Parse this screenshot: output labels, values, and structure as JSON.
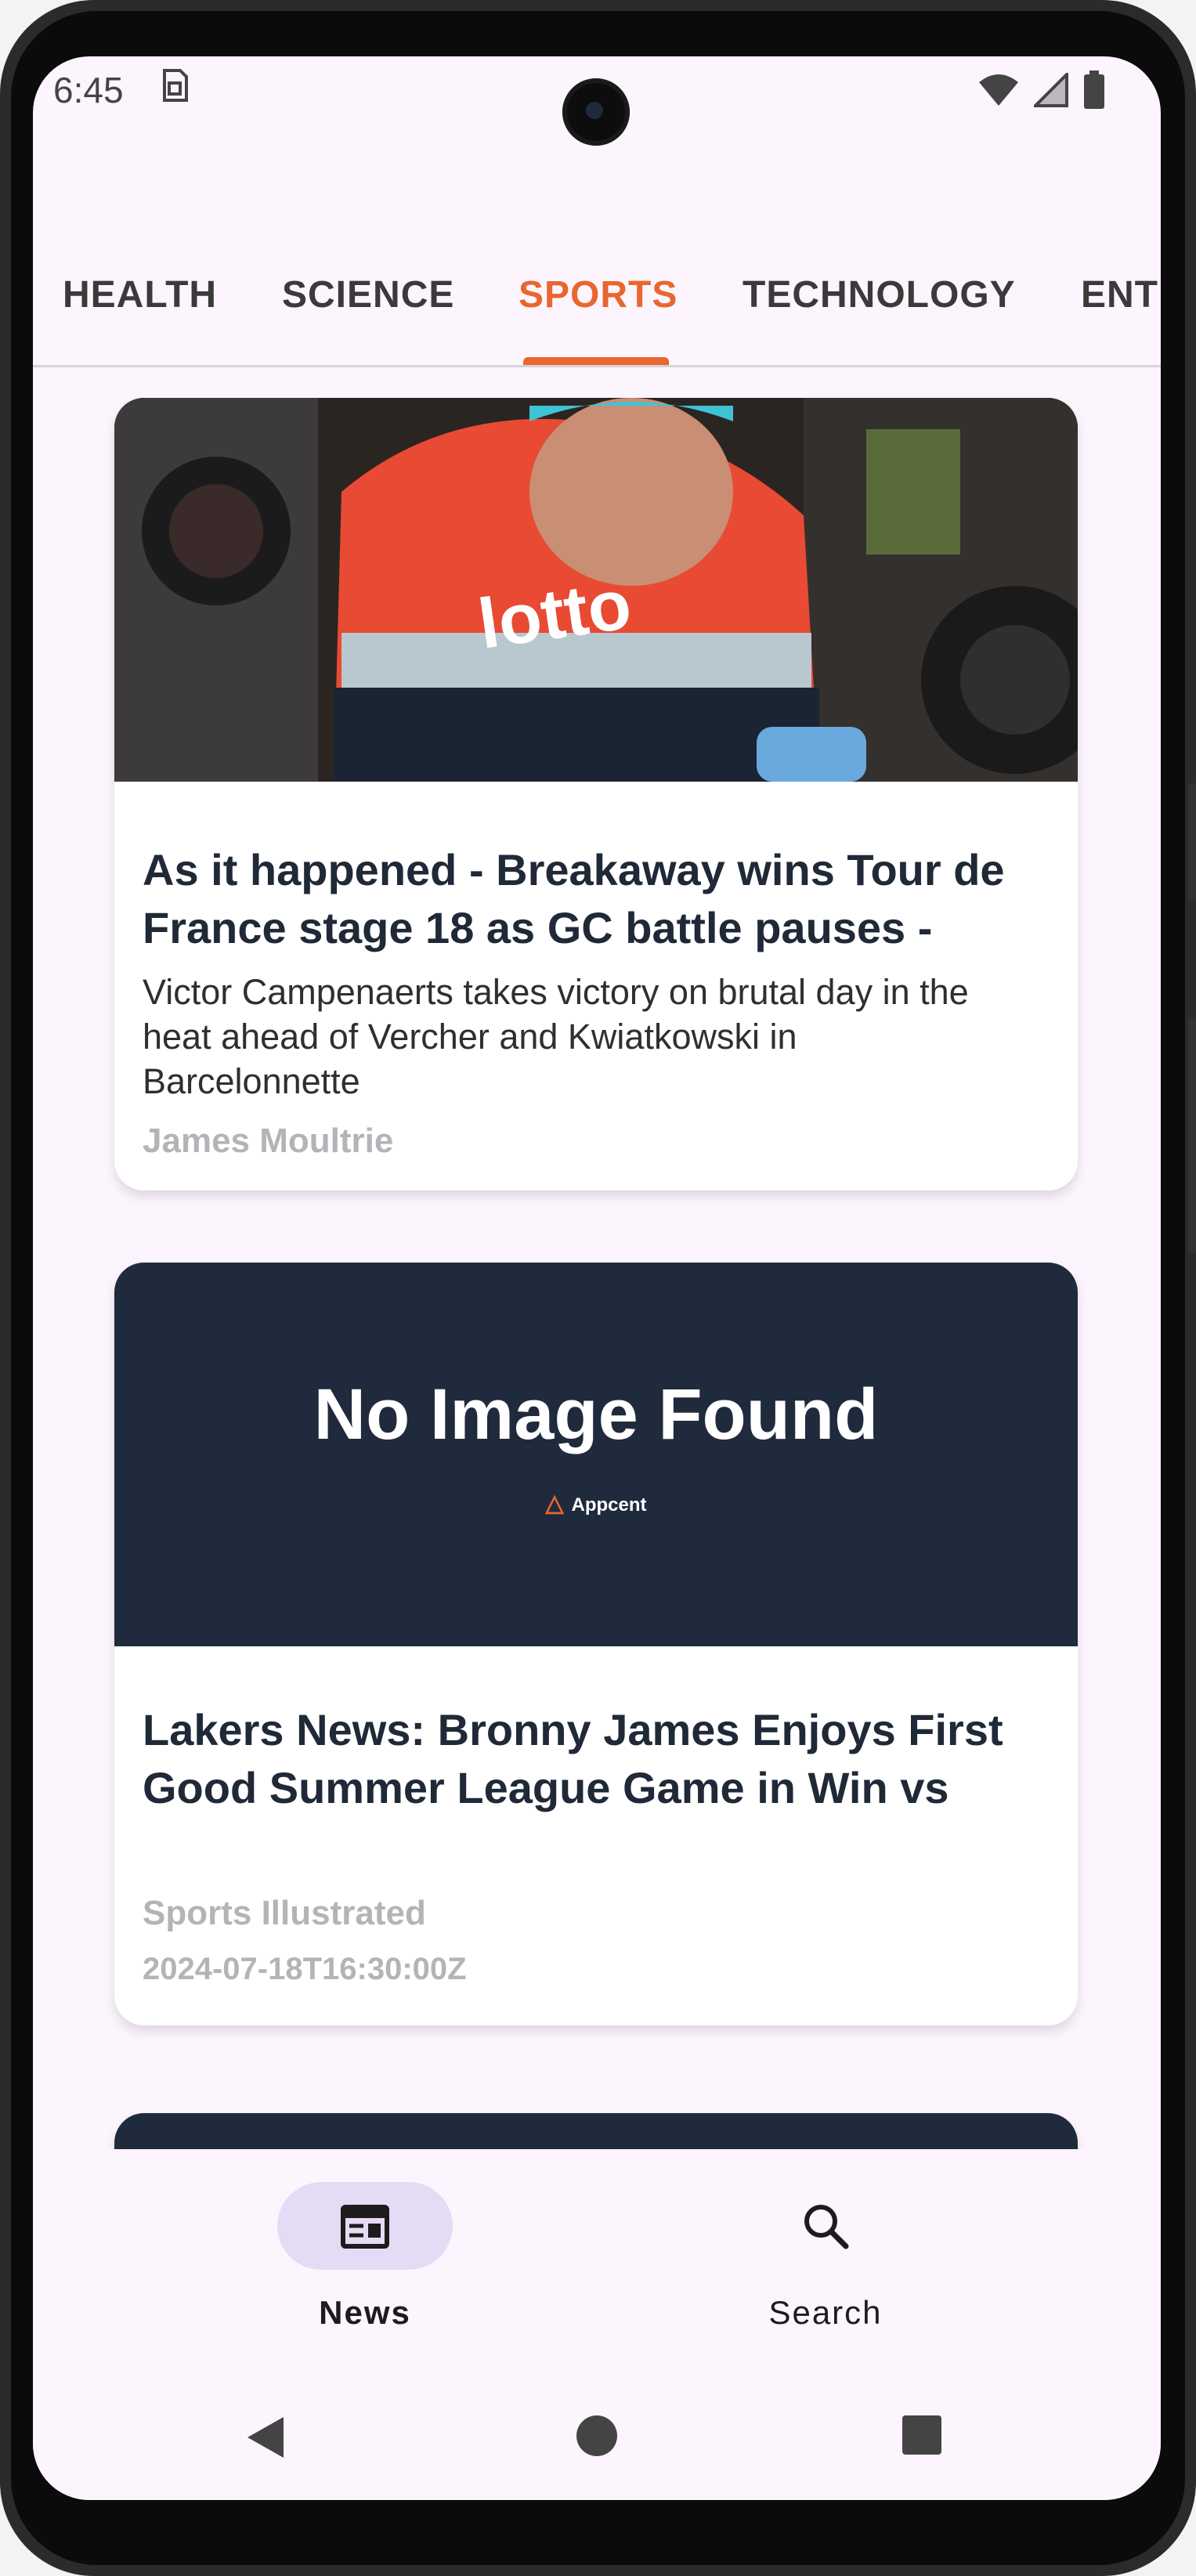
{
  "status_bar": {
    "time": "6:45"
  },
  "tabs": [
    {
      "label": "HEALTH",
      "active": false
    },
    {
      "label": "SCIENCE",
      "active": false
    },
    {
      "label": "SPORTS",
      "active": true
    },
    {
      "label": "TECHNOLOGY",
      "active": false
    },
    {
      "label": "ENTI",
      "active": false
    }
  ],
  "articles": [
    {
      "title": "As it happened - Breakaway wins Tour de France stage 18 as GC battle pauses -",
      "description": "Victor Campenaerts takes victory on brutal day in the heat ahead of Vercher and Kwiatkowski in Barcelonnette",
      "author": "James Moultrie",
      "published_at": "",
      "has_image": true
    },
    {
      "title": "Lakers News: Bronny James Enjoys First Good Summer League Game in Win vs",
      "description": "",
      "author": "Sports Illustrated",
      "published_at": "2024-07-18T16:30:00Z",
      "has_image": false,
      "placeholder": {
        "text": "No Image Found",
        "brand": "Appcent"
      }
    },
    {
      "title": "",
      "has_image": false
    }
  ],
  "bottom_nav": [
    {
      "label": "News",
      "icon": "newspaper-icon",
      "active": true
    },
    {
      "label": "Search",
      "icon": "search-icon",
      "active": false
    }
  ],
  "colors": {
    "accent": "#e8672f",
    "placeholder_bg": "#1f2a3d",
    "screen_bg": "#fcf5fd",
    "nav_active_pill": "#e6dbf5"
  }
}
